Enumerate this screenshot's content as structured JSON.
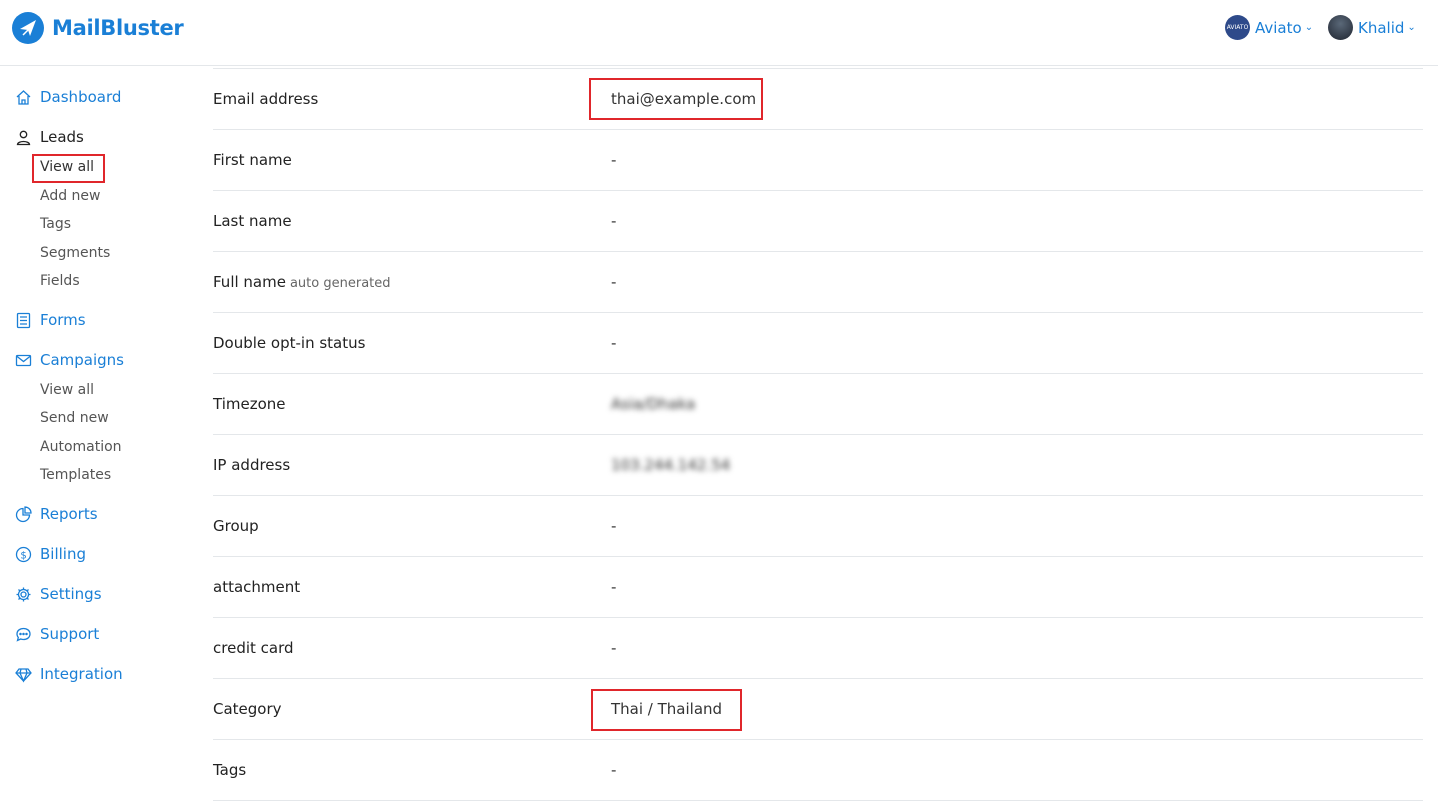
{
  "brand": {
    "name": "MailBluster"
  },
  "accounts": [
    {
      "name": "Aviato",
      "avatar_text": "AVIATO"
    },
    {
      "name": "Khalid"
    }
  ],
  "sidebar": {
    "dashboard": "Dashboard",
    "leads": "Leads",
    "leads_sub": [
      "View all",
      "Add new",
      "Tags",
      "Segments",
      "Fields"
    ],
    "forms": "Forms",
    "campaigns": "Campaigns",
    "campaigns_sub": [
      "View all",
      "Send new",
      "Automation",
      "Templates"
    ],
    "reports": "Reports",
    "billing": "Billing",
    "settings": "Settings",
    "support": "Support",
    "integration": "Integration"
  },
  "fields": [
    {
      "label": "Email address",
      "value": "thai@example.com"
    },
    {
      "label": "First name",
      "value": "-"
    },
    {
      "label": "Last name",
      "value": "-"
    },
    {
      "label": "Full name",
      "aux": "auto generated",
      "value": "-"
    },
    {
      "label": "Double opt-in status",
      "value": "-"
    },
    {
      "label": "Timezone",
      "value": "Asia/Dhaka"
    },
    {
      "label": "IP address",
      "value": "103.244.142.54"
    },
    {
      "label": "Group",
      "value": "-"
    },
    {
      "label": "attachment",
      "value": "-"
    },
    {
      "label": "credit card",
      "value": "-"
    },
    {
      "label": "Category",
      "value": "Thai / Thailand"
    },
    {
      "label": "Tags",
      "value": "-"
    }
  ],
  "colors": {
    "accent": "#1a7fd6",
    "highlight": "#e0262b"
  }
}
